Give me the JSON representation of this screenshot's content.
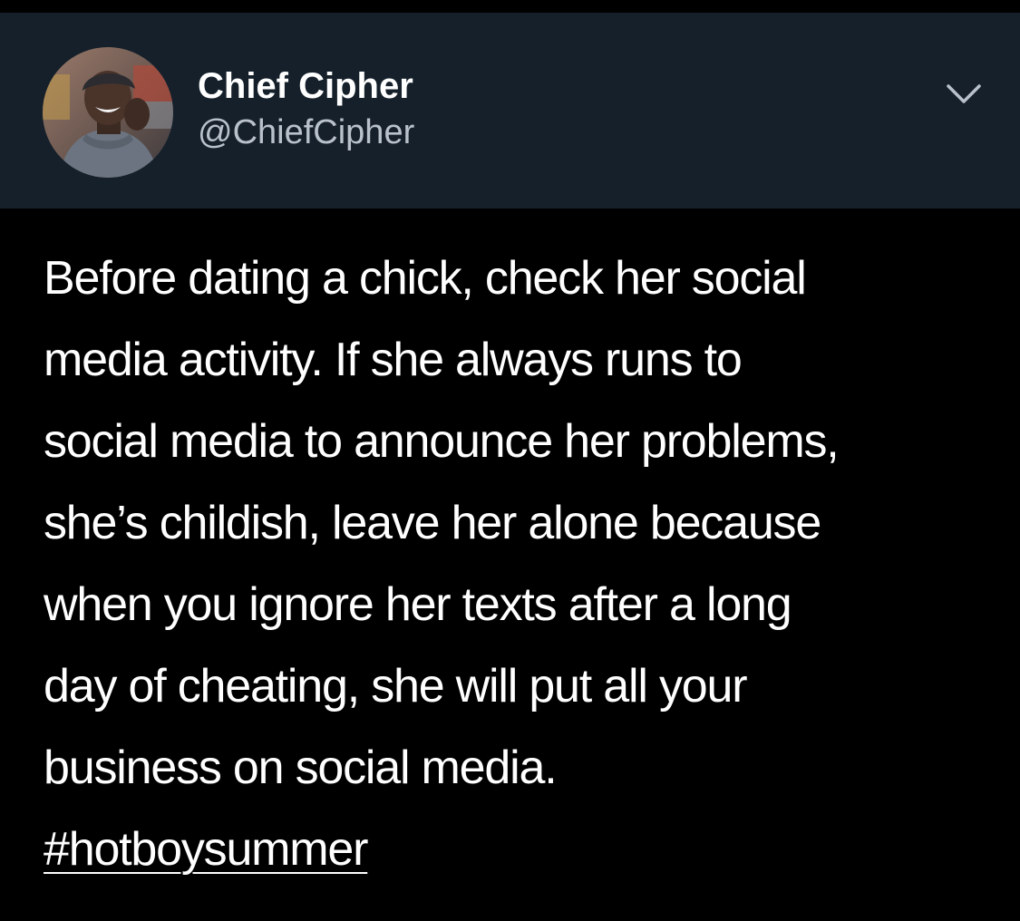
{
  "colors": {
    "header_background": "#15202b",
    "page_background": "#000000",
    "name_color": "#ffffff",
    "handle_color": "#b9c2cb",
    "body_text_color": "#ffffff"
  },
  "author": {
    "display_name": "Chief Cipher",
    "handle": "@ChiefCipher",
    "avatar_icon": "profile-photo"
  },
  "header": {
    "menu_icon": "chevron-down-icon"
  },
  "tweet": {
    "lines": [
      "Before dating a chick, check her social",
      "media activity. If she always runs to",
      "social media to announce her problems,",
      "she’s childish, leave her alone because",
      "when you ignore her texts after a long",
      "day of cheating, she will put all your",
      "business on social media."
    ],
    "hashtag": "#hotboysummer"
  }
}
